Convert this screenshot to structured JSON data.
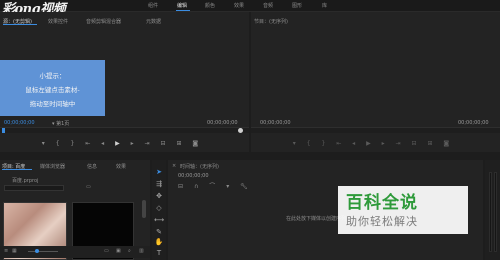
{
  "logo": "彩ong视频",
  "workspace_tabs": [
    "组件",
    "编辑",
    "颜色",
    "效果",
    "音频",
    "图形",
    "库"
  ],
  "source_panel": {
    "tabs": [
      "源：(无剪辑)",
      "效果控件",
      "音频剪辑混合器",
      "元数据"
    ],
    "hint_lines": [
      "小提示：",
      "鼠标左键点击素材-",
      "拖动至时间轴中"
    ],
    "timecode_left": "00;00;00;00",
    "page": "第1页",
    "timecode_right": "00;00;00;00"
  },
  "program_panel": {
    "title": "节目：(无序列)",
    "timecode_left": "00;00;00;00",
    "timecode_right": "00;00;00;00"
  },
  "project_panel": {
    "tabs": [
      "项目: 百度",
      "媒体浏览器",
      "信息",
      "效果"
    ],
    "file": "百度.prproj"
  },
  "timeline_panel": {
    "title": "时间轴：(无序列)",
    "timecode": "00;00;00;00",
    "empty_text": "在此处放下媒体以创建序列"
  },
  "watermark": {
    "big": "百科全说",
    "small": "助你轻松解决"
  },
  "colors": {
    "accent": "#3b8ce0",
    "hint_bg": "#5f93d6",
    "watermark_green": "#2e9a3a"
  }
}
